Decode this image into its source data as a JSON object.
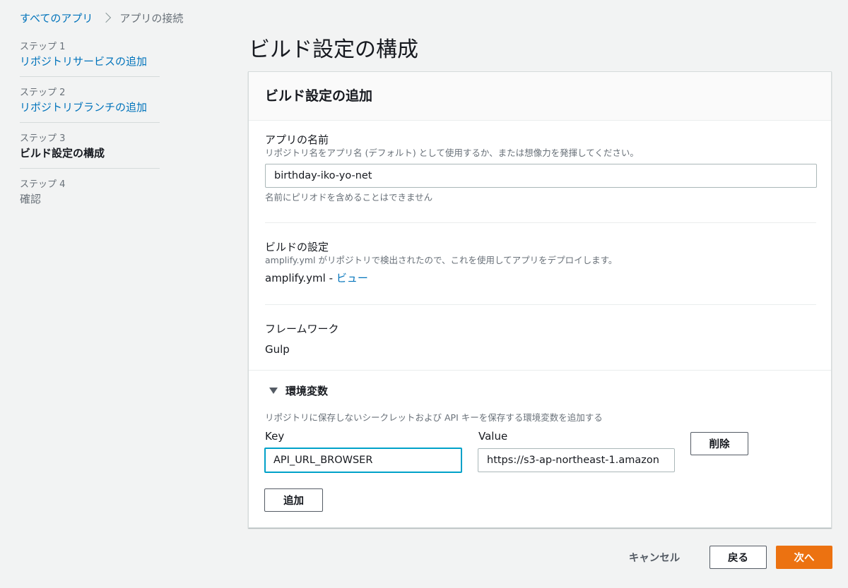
{
  "breadcrumb": {
    "all_apps": "すべてのアプリ",
    "current": "アプリの接続"
  },
  "steps": [
    {
      "num": "ステップ 1",
      "title": "リポジトリサービスの追加",
      "state": "link"
    },
    {
      "num": "ステップ 2",
      "title": "リポジトリブランチの追加",
      "state": "link"
    },
    {
      "num": "ステップ 3",
      "title": "ビルド設定の構成",
      "state": "current"
    },
    {
      "num": "ステップ 4",
      "title": "確認",
      "state": "disabled"
    }
  ],
  "page_title": "ビルド設定の構成",
  "panel": {
    "title": "ビルド設定の追加",
    "app_name": {
      "label": "アプリの名前",
      "description": "リポジトリ名をアプリ名 (デフォルト) として使用するか、または想像力を発揮してください。",
      "value": "birthday-iko-yo-net",
      "hint": "名前にピリオドを含めることはできません"
    },
    "build_settings": {
      "label": "ビルドの設定",
      "description": "amplify.yml がリポジトリで検出されたので、これを使用してアプリをデプロイします。",
      "file_name": "amplify.yml -",
      "view_link": "ビュー"
    },
    "framework": {
      "label": "フレームワーク",
      "value": "Gulp"
    },
    "env_vars": {
      "toggle_label": "環境変数",
      "description": "リポジトリに保存しないシークレットおよび API キーを保存する環境変数を追加する",
      "key_label": "Key",
      "value_label": "Value",
      "key_value": "API_URL_BROWSER",
      "value_value": "https://s3-ap-northeast-1.amazon",
      "delete_button": "削除",
      "add_button": "追加"
    }
  },
  "footer": {
    "cancel": "キャンセル",
    "back": "戻る",
    "next": "次へ"
  },
  "colors": {
    "accent_link": "#0073bb",
    "primary_button": "#ec7211",
    "focus_border": "#00a1c9",
    "page_background": "#f2f3f3"
  }
}
